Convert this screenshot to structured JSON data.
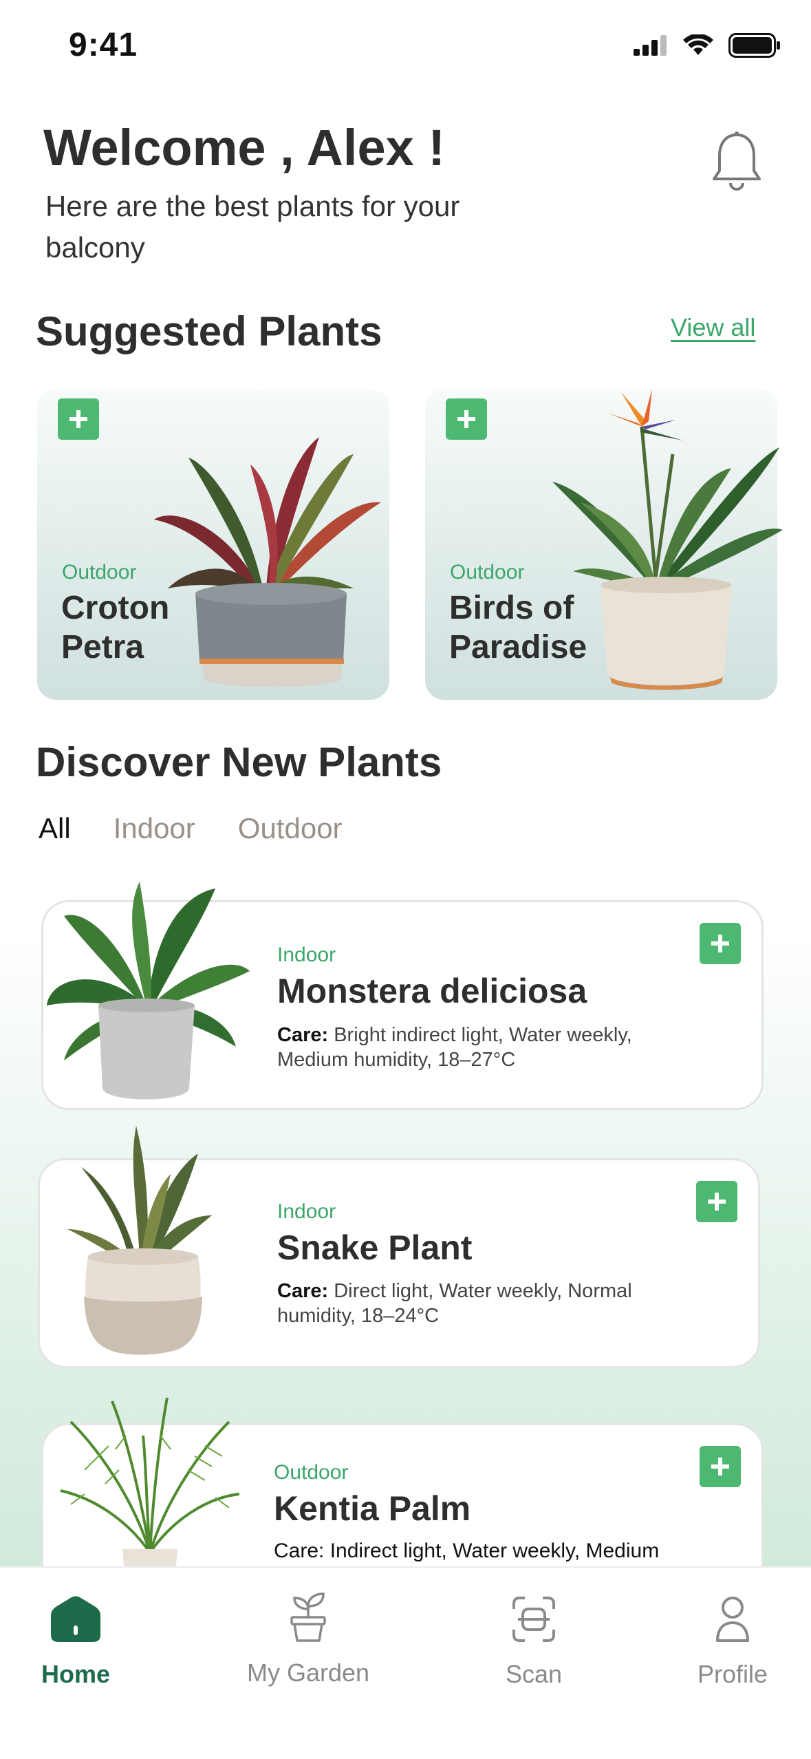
{
  "status_bar": {
    "time": "9:41"
  },
  "header": {
    "welcome": "Welcome , Alex !",
    "subtitle": "Here are the best plants for your balcony",
    "bell_icon": "bell-icon"
  },
  "suggested": {
    "title": "Suggested Plants",
    "view_all": "View all",
    "cards": [
      {
        "tag": "Outdoor",
        "name": "Croton Petra"
      },
      {
        "tag": "Outdoor",
        "name": "Birds of Paradise"
      }
    ]
  },
  "discover": {
    "title": "Discover New Plants",
    "tabs": [
      "All",
      "Indoor",
      "Outdoor"
    ],
    "active_tab": "All",
    "plants": [
      {
        "tag": "Indoor",
        "name": "Monstera deliciosa",
        "care_label": "Care:",
        "care": " Bright indirect light, Water weekly, Medium humidity, 18–27°C"
      },
      {
        "tag": "Indoor",
        "name": "Snake Plant",
        "care_label": "Care:",
        "care": " Direct light, Water weekly, Normal humidity, 18–24°C"
      },
      {
        "tag": "Outdoor",
        "name": "Kentia Palm",
        "care_label": "Care:",
        "care": " Indirect light, Water weekly, Medium"
      }
    ]
  },
  "bottom_nav": {
    "items": [
      {
        "label": "Home",
        "icon": "home-icon",
        "active": true
      },
      {
        "label": "My Garden",
        "icon": "sprout-pot-icon",
        "active": false
      },
      {
        "label": "Scan",
        "icon": "scan-icon",
        "active": false
      },
      {
        "label": "Profile",
        "icon": "user-icon",
        "active": false
      }
    ]
  },
  "colors": {
    "accent_green": "#4cb872",
    "tag_green": "#3aa66a",
    "nav_active": "#1d6b4a",
    "text_dark": "#2e2e2e"
  }
}
